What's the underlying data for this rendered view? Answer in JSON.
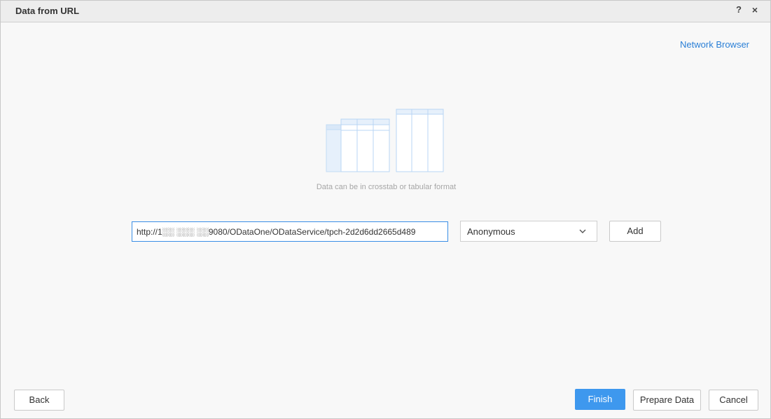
{
  "dialog": {
    "title": "Data from URL",
    "help_glyph": "?",
    "close_glyph": "×"
  },
  "links": {
    "network_browser": "Network Browser"
  },
  "illustration": {
    "icon": "crosstab-table-illustration",
    "hint": "Data can be in crosstab or tabular format"
  },
  "url_field": {
    "value": "http://1░░ ░░░ ░░9080/ODataOne/ODataService/tpch-2d2d6dd2665d489"
  },
  "auth_select": {
    "selected": "Anonymous",
    "icon": "chevron-down-icon"
  },
  "buttons": {
    "add": "Add",
    "back": "Back",
    "finish": "Finish",
    "prepare": "Prepare Data",
    "cancel": "Cancel"
  },
  "colors": {
    "accent": "#3e98ee",
    "link": "#2a7fd6",
    "illustration_fill": "#eaf3fd",
    "illustration_stroke": "#b9d6f4"
  }
}
